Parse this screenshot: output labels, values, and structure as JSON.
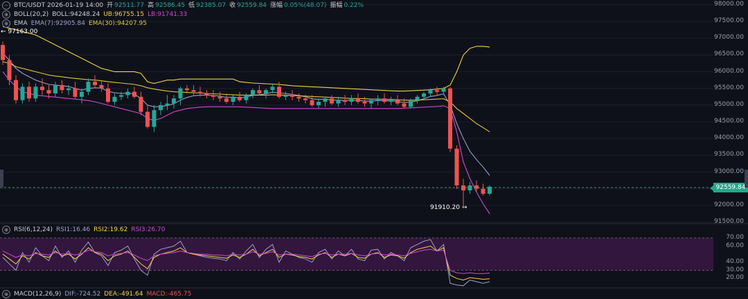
{
  "header": {
    "symbol_time": "BTC/USDT  2026-01-19 14:00",
    "open_label": "开",
    "open": "92511.77",
    "high_label": "高",
    "high": "92586.45",
    "low_label": "低",
    "low": "92385.07",
    "close_label": "收",
    "close": "92559.84",
    "change_label": "涨幅",
    "change": "0.05%(48.07)",
    "amp_label": "振幅",
    "amp": "0.22%"
  },
  "boll": {
    "name": "BOLL(20,2)",
    "boll": "BOLL:94248.24",
    "ub": "UB:96755.15",
    "lb": "LB:91741.33"
  },
  "ema": {
    "name": "EMA",
    "ema7": "EMA(7):92905.84",
    "ema30": "EMA(30):94207.95"
  },
  "rsi": {
    "name": "RSI(6,12,24)",
    "rsi1": "RSI1:16.46",
    "rsi2": "RSI2:19.62",
    "rsi3": "RSI3:26.70"
  },
  "macd": {
    "name": "MACD(12,26,9)",
    "dif": "DIF:-724.52",
    "dea": "DEA:-491.64",
    "macd": "MACD:-465.75"
  },
  "price_axis": [
    "98000.00",
    "97500.00",
    "97000.00",
    "96500.00",
    "96000.00",
    "95500.00",
    "95000.00",
    "94500.00",
    "94000.00",
    "93500.00",
    "93000.00",
    "92500.00",
    "92000.00",
    "91500.00"
  ],
  "rsi_axis": [
    "70.00",
    "60.00",
    "40.00",
    "30.00",
    "20.00"
  ],
  "last_price": "92559.84",
  "high_marker": "97163.00",
  "low_marker": "91910.20",
  "colors": {
    "up": "#26a69a",
    "down": "#ef5350",
    "ub": "#f0d24a",
    "lb": "#d04ad0",
    "ema7": "#9aa0c8",
    "ema30": "#e0c640",
    "rsi_band": "#3a1844"
  },
  "chart_data": {
    "type": "candlestick",
    "ylim": [
      91500,
      98000
    ],
    "candles": [
      [
        96800,
        96900,
        96200,
        96350
      ],
      [
        96350,
        96500,
        95600,
        95750
      ],
      [
        95750,
        95900,
        95050,
        95150
      ],
      [
        95150,
        95650,
        95050,
        95550
      ],
      [
        95550,
        95700,
        95100,
        95200
      ],
      [
        95200,
        95650,
        95100,
        95550
      ],
      [
        95550,
        95800,
        95300,
        95450
      ],
      [
        95450,
        95600,
        95200,
        95350
      ],
      [
        95350,
        95700,
        95250,
        95600
      ],
      [
        95600,
        95750,
        95350,
        95450
      ],
      [
        95450,
        95600,
        95300,
        95500
      ],
      [
        95500,
        95700,
        95200,
        95250
      ],
      [
        95250,
        95500,
        95050,
        95400
      ],
      [
        95400,
        95800,
        95300,
        95700
      ],
      [
        95700,
        95900,
        95500,
        95600
      ],
      [
        95600,
        95750,
        95400,
        95500
      ],
      [
        95500,
        95650,
        95050,
        95100
      ],
      [
        95100,
        95350,
        95000,
        95250
      ],
      [
        95250,
        95400,
        95150,
        95300
      ],
      [
        95300,
        95500,
        95200,
        95400
      ],
      [
        95400,
        95550,
        95200,
        95250
      ],
      [
        95250,
        95400,
        94700,
        94800
      ],
      [
        94800,
        95000,
        94300,
        94350
      ],
      [
        94350,
        95000,
        94200,
        94850
      ],
      [
        94850,
        95100,
        94700,
        95000
      ],
      [
        95000,
        95300,
        94850,
        95050
      ],
      [
        95050,
        95300,
        94900,
        95200
      ],
      [
        95200,
        95550,
        95000,
        95500
      ],
      [
        95500,
        95600,
        95350,
        95450
      ],
      [
        95450,
        95600,
        95300,
        95400
      ],
      [
        95400,
        95550,
        95250,
        95350
      ],
      [
        95350,
        95450,
        95200,
        95300
      ],
      [
        95300,
        95450,
        95150,
        95250
      ],
      [
        95250,
        95400,
        95100,
        95200
      ],
      [
        95200,
        95350,
        95050,
        95100
      ],
      [
        95100,
        95300,
        95000,
        95250
      ],
      [
        95250,
        95400,
        95100,
        95150
      ],
      [
        95150,
        95350,
        95050,
        95300
      ],
      [
        95300,
        95500,
        95200,
        95450
      ],
      [
        95450,
        95600,
        95300,
        95350
      ],
      [
        95350,
        95500,
        95200,
        95450
      ],
      [
        95450,
        95650,
        95350,
        95550
      ],
      [
        95550,
        95700,
        95200,
        95250
      ],
      [
        95250,
        95400,
        95150,
        95300
      ],
      [
        95300,
        95450,
        95150,
        95250
      ],
      [
        95250,
        95350,
        95100,
        95200
      ],
      [
        95200,
        95300,
        95050,
        95150
      ],
      [
        95150,
        95300,
        94950,
        95000
      ],
      [
        95000,
        95200,
        94900,
        95100
      ],
      [
        95100,
        95250,
        94950,
        95200
      ],
      [
        95200,
        95300,
        95000,
        95050
      ],
      [
        95050,
        95250,
        94950,
        95150
      ],
      [
        95150,
        95300,
        95000,
        95100
      ],
      [
        95100,
        95300,
        95000,
        95200
      ],
      [
        95200,
        95350,
        95050,
        95100
      ],
      [
        95100,
        95250,
        94950,
        95050
      ],
      [
        95050,
        95200,
        94900,
        95150
      ],
      [
        95150,
        95300,
        95000,
        95200
      ],
      [
        95200,
        95350,
        95050,
        95100
      ],
      [
        95100,
        95250,
        95000,
        95150
      ],
      [
        95150,
        95300,
        95000,
        95050
      ],
      [
        95050,
        95200,
        94900,
        94950
      ],
      [
        94950,
        95200,
        94900,
        95150
      ],
      [
        95150,
        95300,
        95050,
        95250
      ],
      [
        95250,
        95400,
        95150,
        95350
      ],
      [
        95350,
        95500,
        95250,
        95450
      ],
      [
        95450,
        95550,
        95300,
        95400
      ],
      [
        95400,
        95550,
        95300,
        95500
      ],
      [
        95500,
        95550,
        93600,
        93700
      ],
      [
        93700,
        93800,
        92500,
        92600
      ],
      [
        92600,
        92800,
        91910,
        92450
      ],
      [
        92450,
        92700,
        92350,
        92600
      ],
      [
        92600,
        92750,
        92400,
        92500
      ],
      [
        92500,
        92650,
        92300,
        92350
      ],
      [
        92350,
        92600,
        92300,
        92560
      ]
    ],
    "ub": [
      97350,
      97300,
      97250,
      97200,
      97150,
      97100,
      97000,
      96900,
      96800,
      96700,
      96600,
      96500,
      96400,
      96300,
      96200,
      96100,
      96050,
      96000,
      96000,
      96000,
      96000,
      95950,
      95700,
      95650,
      95700,
      95750,
      95750,
      95780,
      95780,
      95780,
      95780,
      95780,
      95780,
      95780,
      95780,
      95780,
      95700,
      95680,
      95660,
      95650,
      95640,
      95630,
      95620,
      95600,
      95580,
      95570,
      95560,
      95550,
      95540,
      95530,
      95520,
      95510,
      95500,
      95490,
      95480,
      95470,
      95460,
      95450,
      95440,
      95430,
      95420,
      95420,
      95430,
      95440,
      95450,
      95460,
      95480,
      95500,
      95600,
      96000,
      96500,
      96700,
      96760,
      96760,
      96740
    ],
    "lb": [
      96000,
      95750,
      95550,
      95400,
      95350,
      95300,
      95280,
      95260,
      95240,
      95220,
      95200,
      95180,
      95160,
      95140,
      95100,
      95050,
      95000,
      94950,
      94900,
      94850,
      94800,
      94750,
      94600,
      94550,
      94600,
      94700,
      94800,
      94850,
      94900,
      94920,
      94940,
      94950,
      94950,
      94950,
      94950,
      94950,
      94950,
      94940,
      94930,
      94920,
      94910,
      94900,
      94900,
      94900,
      94900,
      94900,
      94900,
      94900,
      94900,
      94900,
      94900,
      94900,
      94900,
      94900,
      94900,
      94900,
      94900,
      94900,
      94900,
      94900,
      94900,
      94910,
      94920,
      94930,
      94940,
      94950,
      94960,
      94980,
      94900,
      94200,
      93300,
      92800,
      92400,
      92050,
      91750
    ],
    "ema7": [
      96550,
      96350,
      96100,
      95950,
      95850,
      95750,
      95680,
      95620,
      95600,
      95580,
      95560,
      95500,
      95450,
      95500,
      95520,
      95510,
      95410,
      95370,
      95350,
      95360,
      95330,
      95200,
      95000,
      94950,
      94960,
      94990,
      95040,
      95150,
      95230,
      95280,
      95300,
      95300,
      95290,
      95270,
      95230,
      95240,
      95220,
      95240,
      95290,
      95310,
      95340,
      95390,
      95360,
      95350,
      95320,
      95290,
      95250,
      95190,
      95170,
      95180,
      95150,
      95150,
      95140,
      95150,
      95140,
      95120,
      95120,
      95140,
      95130,
      95130,
      95110,
      95080,
      95090,
      95130,
      95190,
      95260,
      95290,
      95340,
      95000,
      94450,
      94000,
      93620,
      93370,
      93150,
      92900
    ],
    "ema30": [
      96300,
      96250,
      96150,
      96100,
      96050,
      96000,
      95950,
      95900,
      95870,
      95850,
      95820,
      95800,
      95780,
      95760,
      95750,
      95730,
      95700,
      95680,
      95660,
      95640,
      95620,
      95580,
      95520,
      95480,
      95450,
      95420,
      95400,
      95390,
      95380,
      95370,
      95360,
      95350,
      95340,
      95330,
      95320,
      95310,
      95300,
      95300,
      95300,
      95300,
      95300,
      95310,
      95300,
      95300,
      95290,
      95280,
      95270,
      95260,
      95250,
      95240,
      95230,
      95220,
      95210,
      95200,
      95200,
      95190,
      95180,
      95180,
      95170,
      95170,
      95160,
      95150,
      95150,
      95150,
      95160,
      95170,
      95180,
      95190,
      95100,
      94900,
      94750,
      94600,
      94450,
      94330,
      94200
    ],
    "rsi_ylim": [
      10,
      75
    ],
    "rsi1": [
      46,
      38,
      30,
      52,
      40,
      58,
      48,
      42,
      60,
      46,
      54,
      40,
      55,
      65,
      52,
      48,
      36,
      52,
      55,
      60,
      44,
      30,
      24,
      50,
      56,
      58,
      60,
      66,
      52,
      50,
      48,
      46,
      45,
      44,
      42,
      52,
      44,
      54,
      62,
      46,
      56,
      62,
      40,
      54,
      50,
      46,
      44,
      40,
      52,
      56,
      44,
      54,
      48,
      56,
      44,
      42,
      55,
      56,
      44,
      52,
      48,
      42,
      58,
      62,
      66,
      68,
      54,
      62,
      14,
      12,
      11,
      18,
      16,
      14,
      16
    ],
    "rsi2": [
      50,
      44,
      38,
      48,
      44,
      52,
      48,
      46,
      54,
      48,
      50,
      44,
      50,
      58,
      52,
      50,
      42,
      48,
      50,
      54,
      46,
      38,
      32,
      46,
      50,
      52,
      54,
      58,
      52,
      50,
      49,
      48,
      47,
      46,
      45,
      49,
      46,
      50,
      56,
      48,
      52,
      56,
      46,
      50,
      49,
      47,
      46,
      44,
      49,
      52,
      46,
      50,
      48,
      51,
      46,
      45,
      50,
      52,
      46,
      49,
      48,
      45,
      52,
      56,
      58,
      60,
      54,
      58,
      24,
      20,
      18,
      21,
      20,
      19,
      19.6
    ],
    "rsi3": [
      54,
      50,
      46,
      49,
      48,
      51,
      50,
      49,
      52,
      50,
      51,
      49,
      51,
      55,
      53,
      52,
      48,
      50,
      51,
      52,
      49,
      45,
      42,
      48,
      50,
      51,
      52,
      54,
      52,
      51,
      50,
      50,
      49,
      49,
      48,
      50,
      49,
      50,
      53,
      50,
      51,
      53,
      49,
      50,
      50,
      49,
      48,
      47,
      50,
      51,
      49,
      50,
      50,
      51,
      49,
      48,
      50,
      51,
      49,
      50,
      49,
      48,
      51,
      53,
      55,
      56,
      54,
      55,
      30,
      27,
      26,
      27,
      26,
      26,
      26.7
    ]
  }
}
